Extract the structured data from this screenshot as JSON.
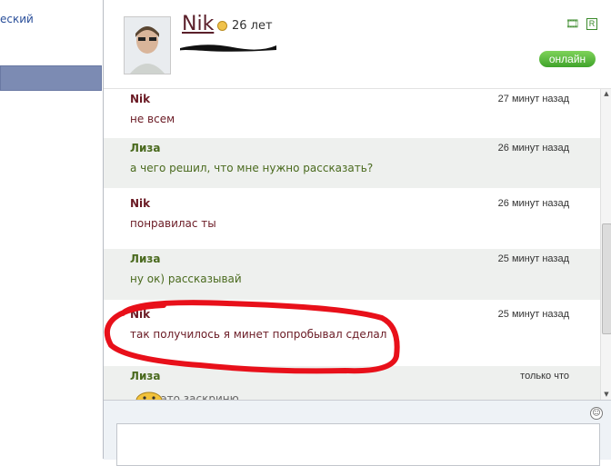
{
  "sidebar": {
    "partial_link": "еский"
  },
  "header": {
    "name": "Nik",
    "age": "26 лет",
    "status": "онлайн",
    "icons": [
      "film-icon",
      "r-icon"
    ]
  },
  "messages": [
    {
      "author": "Nik",
      "time": "27 минут назад",
      "text": "не всем"
    },
    {
      "author": "Лиза",
      "time": "26 минут назад",
      "text": "а чего решил, что мне нужно рассказать?"
    },
    {
      "author": "Nik",
      "time": "26 минут назад",
      "text": "понравилас ты"
    },
    {
      "author": "Лиза",
      "time": "25 минут назад",
      "text": "ну ок) рассказывай"
    },
    {
      "author": "Nik",
      "time": "25 минут назад",
      "text": "так получилось я минет попробывал сделал"
    },
    {
      "author": "Лиза",
      "time": "только что",
      "text": "я это заскриню"
    }
  ],
  "colors": {
    "nik": "#6a1a24",
    "liza": "#4a6a1e",
    "online": "#3fa32a",
    "annotation": "#e8101a"
  }
}
